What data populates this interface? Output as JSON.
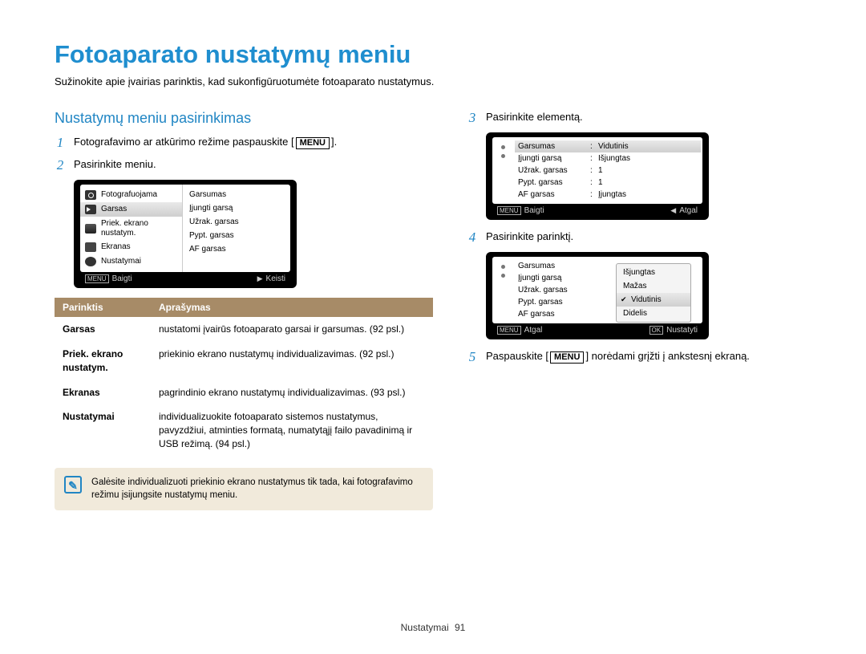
{
  "title": "Fotoaparato nustatymų meniu",
  "subtitle": "Sužinokite apie įvairias parinktis, kad sukonfigūruotumėte fotoaparato nustatymus.",
  "section_head": "Nustatymų meniu pasirinkimas",
  "steps": {
    "s1_pre": "Fotografavimo ar atkūrimo režime paspauskite [",
    "s1_btn": "MENU",
    "s1_post": "].",
    "s2": "Pasirinkite meniu.",
    "s3": "Pasirinkite elementą.",
    "s4": "Pasirinkite parinktį.",
    "s5_pre": "Paspauskite [",
    "s5_btn": "MENU",
    "s5_post": "] norėdami grįžti į ankstesnį ekraną."
  },
  "screen1": {
    "left": [
      "Fotografuojama",
      "Garsas",
      "Priek. ekrano nustatym.",
      "Ekranas",
      "Nustatymai"
    ],
    "right": [
      "Garsumas",
      "Įjungti garsą",
      "Užrak. garsas",
      "Pypt. garsas",
      "AF garsas"
    ],
    "foot_left_icon": "MENU",
    "foot_left": "Baigti",
    "foot_right": "Keisti"
  },
  "screen2": {
    "rows": [
      {
        "label": "Garsumas",
        "value": "Vidutinis",
        "sel": true
      },
      {
        "label": "Įjungti garsą",
        "value": "Išjungtas"
      },
      {
        "label": "Užrak. garsas",
        "value": "1"
      },
      {
        "label": "Pypt. garsas",
        "value": "1"
      },
      {
        "label": "AF garsas",
        "value": "Įjungtas"
      }
    ],
    "foot_left_icon": "MENU",
    "foot_left": "Baigti",
    "foot_right": "Atgal"
  },
  "screen3": {
    "rows": [
      {
        "label": "Garsumas"
      },
      {
        "label": "Įjungti garsą"
      },
      {
        "label": "Užrak. garsas"
      },
      {
        "label": "Pypt. garsas"
      },
      {
        "label": "AF garsas"
      }
    ],
    "popup": [
      "Išjungtas",
      "Mažas",
      "Vidutinis",
      "Didelis"
    ],
    "popup_sel": "Vidutinis",
    "foot_left_icon": "MENU",
    "foot_left": "Atgal",
    "foot_right_icon": "OK",
    "foot_right": "Nustatyti"
  },
  "table": {
    "h1": "Parinktis",
    "h2": "Aprašymas",
    "rows": [
      {
        "k": "Garsas",
        "v": "nustatomi įvairūs fotoaparato garsai ir garsumas. (92 psl.)"
      },
      {
        "k": "Priek. ekrano nustatym.",
        "v": "priekinio ekrano nustatymų individualizavimas. (92 psl.)"
      },
      {
        "k": "Ekranas",
        "v": "pagrindinio ekrano nustatymų individualizavimas. (93 psl.)"
      },
      {
        "k": "Nustatymai",
        "v": "individualizuokite fotoaparato sistemos nustatymus, pavyzdžiui, atminties formatą, numatytąjį failo pavadinimą ir USB režimą. (94 psl.)"
      }
    ]
  },
  "note_icon": "✎",
  "note": "Galėsite individualizuoti priekinio ekrano nustatymus tik tada, kai fotografavimo režimu įsijungsite nustatymų meniu.",
  "footer_label": "Nustatymai",
  "footer_page": "91"
}
